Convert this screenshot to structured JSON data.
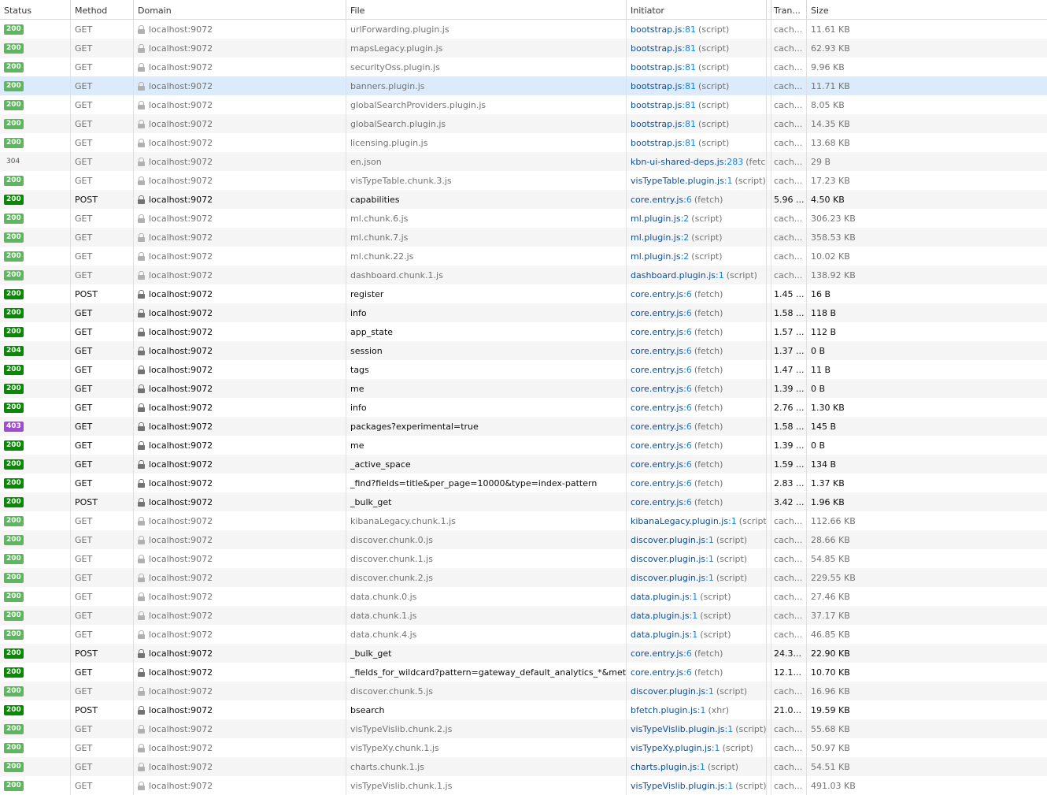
{
  "headers": {
    "status": "Status",
    "method": "Method",
    "domain": "Domain",
    "file": "File",
    "initiator": "Initiator",
    "transferred": "Tran...",
    "size": "Size"
  },
  "colors": {
    "status_ok": "#058b00",
    "status_ok_cached": "#5cb85c",
    "status_forbidden": "#a24ad6",
    "selected_row": "#dcebfb",
    "link": "#0a4ea5"
  },
  "rows": [
    {
      "status": "200",
      "method": "GET",
      "domain": "localhost:9072",
      "file": "urlForwarding.plugin.js",
      "initiator": "bootstrap.js",
      "line": ":81",
      "type": "(script)",
      "transferred": "cach...",
      "size": "11.61 KB",
      "cached": true
    },
    {
      "status": "200",
      "method": "GET",
      "domain": "localhost:9072",
      "file": "mapsLegacy.plugin.js",
      "initiator": "bootstrap.js",
      "line": ":81",
      "type": "(script)",
      "transferred": "cach...",
      "size": "62.93 KB",
      "cached": true
    },
    {
      "status": "200",
      "method": "GET",
      "domain": "localhost:9072",
      "file": "securityOss.plugin.js",
      "initiator": "bootstrap.js",
      "line": ":81",
      "type": "(script)",
      "transferred": "cach...",
      "size": "9.96 KB",
      "cached": true
    },
    {
      "status": "200",
      "method": "GET",
      "domain": "localhost:9072",
      "file": "banners.plugin.js",
      "initiator": "bootstrap.js",
      "line": ":81",
      "type": "(script)",
      "transferred": "cach...",
      "size": "11.71 KB",
      "cached": true,
      "selected": true
    },
    {
      "status": "200",
      "method": "GET",
      "domain": "localhost:9072",
      "file": "globalSearchProviders.plugin.js",
      "initiator": "bootstrap.js",
      "line": ":81",
      "type": "(script)",
      "transferred": "cach...",
      "size": "8.05 KB",
      "cached": true
    },
    {
      "status": "200",
      "method": "GET",
      "domain": "localhost:9072",
      "file": "globalSearch.plugin.js",
      "initiator": "bootstrap.js",
      "line": ":81",
      "type": "(script)",
      "transferred": "cach...",
      "size": "14.35 KB",
      "cached": true
    },
    {
      "status": "200",
      "method": "GET",
      "domain": "localhost:9072",
      "file": "licensing.plugin.js",
      "initiator": "bootstrap.js",
      "line": ":81",
      "type": "(script)",
      "transferred": "cach...",
      "size": "13.68 KB",
      "cached": true
    },
    {
      "status": "304",
      "method": "GET",
      "domain": "localhost:9072",
      "file": "en.json",
      "initiator": "kbn-ui-shared-deps.js",
      "line": ":283",
      "type": "(fetc...",
      "transferred": "cach...",
      "size": "29 B",
      "cached": true
    },
    {
      "status": "200",
      "method": "GET",
      "domain": "localhost:9072",
      "file": "visTypeTable.chunk.3.js",
      "initiator": "visTypeTable.plugin.js",
      "line": ":1",
      "type": "(script)",
      "transferred": "cach...",
      "size": "17.23 KB",
      "cached": true
    },
    {
      "status": "200",
      "method": "POST",
      "domain": "localhost:9072",
      "file": "capabilities",
      "initiator": "core.entry.js",
      "line": ":6",
      "type": "(fetch)",
      "transferred": "5.96 ...",
      "size": "4.50 KB",
      "cached": false
    },
    {
      "status": "200",
      "method": "GET",
      "domain": "localhost:9072",
      "file": "ml.chunk.6.js",
      "initiator": "ml.plugin.js",
      "line": ":2",
      "type": "(script)",
      "transferred": "cach...",
      "size": "306.23 KB",
      "cached": true
    },
    {
      "status": "200",
      "method": "GET",
      "domain": "localhost:9072",
      "file": "ml.chunk.7.js",
      "initiator": "ml.plugin.js",
      "line": ":2",
      "type": "(script)",
      "transferred": "cach...",
      "size": "358.53 KB",
      "cached": true
    },
    {
      "status": "200",
      "method": "GET",
      "domain": "localhost:9072",
      "file": "ml.chunk.22.js",
      "initiator": "ml.plugin.js",
      "line": ":2",
      "type": "(script)",
      "transferred": "cach...",
      "size": "10.02 KB",
      "cached": true
    },
    {
      "status": "200",
      "method": "GET",
      "domain": "localhost:9072",
      "file": "dashboard.chunk.1.js",
      "initiator": "dashboard.plugin.js",
      "line": ":1",
      "type": "(script)",
      "transferred": "cach...",
      "size": "138.92 KB",
      "cached": true
    },
    {
      "status": "200",
      "method": "POST",
      "domain": "localhost:9072",
      "file": "register",
      "initiator": "core.entry.js",
      "line": ":6",
      "type": "(fetch)",
      "transferred": "1.45 ...",
      "size": "16 B",
      "cached": false
    },
    {
      "status": "200",
      "method": "GET",
      "domain": "localhost:9072",
      "file": "info",
      "initiator": "core.entry.js",
      "line": ":6",
      "type": "(fetch)",
      "transferred": "1.58 ...",
      "size": "118 B",
      "cached": false
    },
    {
      "status": "200",
      "method": "GET",
      "domain": "localhost:9072",
      "file": "app_state",
      "initiator": "core.entry.js",
      "line": ":6",
      "type": "(fetch)",
      "transferred": "1.57 ...",
      "size": "112 B",
      "cached": false
    },
    {
      "status": "204",
      "method": "GET",
      "domain": "localhost:9072",
      "file": "session",
      "initiator": "core.entry.js",
      "line": ":6",
      "type": "(fetch)",
      "transferred": "1.37 ...",
      "size": "0 B",
      "cached": false
    },
    {
      "status": "200",
      "method": "GET",
      "domain": "localhost:9072",
      "file": "tags",
      "initiator": "core.entry.js",
      "line": ":6",
      "type": "(fetch)",
      "transferred": "1.47 ...",
      "size": "11 B",
      "cached": false
    },
    {
      "status": "200",
      "method": "GET",
      "domain": "localhost:9072",
      "file": "me",
      "initiator": "core.entry.js",
      "line": ":6",
      "type": "(fetch)",
      "transferred": "1.39 ...",
      "size": "0 B",
      "cached": false
    },
    {
      "status": "200",
      "method": "GET",
      "domain": "localhost:9072",
      "file": "info",
      "initiator": "core.entry.js",
      "line": ":6",
      "type": "(fetch)",
      "transferred": "2.76 ...",
      "size": "1.30 KB",
      "cached": false
    },
    {
      "status": "403",
      "method": "GET",
      "domain": "localhost:9072",
      "file": "packages?experimental=true",
      "initiator": "core.entry.js",
      "line": ":6",
      "type": "(fetch)",
      "transferred": "1.58 ...",
      "size": "145 B",
      "cached": false
    },
    {
      "status": "200",
      "method": "GET",
      "domain": "localhost:9072",
      "file": "me",
      "initiator": "core.entry.js",
      "line": ":6",
      "type": "(fetch)",
      "transferred": "1.39 ...",
      "size": "0 B",
      "cached": false
    },
    {
      "status": "200",
      "method": "GET",
      "domain": "localhost:9072",
      "file": "_active_space",
      "initiator": "core.entry.js",
      "line": ":6",
      "type": "(fetch)",
      "transferred": "1.59 ...",
      "size": "134 B",
      "cached": false
    },
    {
      "status": "200",
      "method": "GET",
      "domain": "localhost:9072",
      "file": "_find?fields=title&per_page=10000&type=index-pattern",
      "initiator": "core.entry.js",
      "line": ":6",
      "type": "(fetch)",
      "transferred": "2.83 ...",
      "size": "1.37 KB",
      "cached": false
    },
    {
      "status": "200",
      "method": "POST",
      "domain": "localhost:9072",
      "file": "_bulk_get",
      "initiator": "core.entry.js",
      "line": ":6",
      "type": "(fetch)",
      "transferred": "3.42 ...",
      "size": "1.96 KB",
      "cached": false
    },
    {
      "status": "200",
      "method": "GET",
      "domain": "localhost:9072",
      "file": "kibanaLegacy.chunk.1.js",
      "initiator": "kibanaLegacy.plugin.js",
      "line": ":1",
      "type": "(script)",
      "transferred": "cach...",
      "size": "112.66 KB",
      "cached": true
    },
    {
      "status": "200",
      "method": "GET",
      "domain": "localhost:9072",
      "file": "discover.chunk.0.js",
      "initiator": "discover.plugin.js",
      "line": ":1",
      "type": "(script)",
      "transferred": "cach...",
      "size": "28.66 KB",
      "cached": true
    },
    {
      "status": "200",
      "method": "GET",
      "domain": "localhost:9072",
      "file": "discover.chunk.1.js",
      "initiator": "discover.plugin.js",
      "line": ":1",
      "type": "(script)",
      "transferred": "cach...",
      "size": "54.85 KB",
      "cached": true
    },
    {
      "status": "200",
      "method": "GET",
      "domain": "localhost:9072",
      "file": "discover.chunk.2.js",
      "initiator": "discover.plugin.js",
      "line": ":1",
      "type": "(script)",
      "transferred": "cach...",
      "size": "229.55 KB",
      "cached": true
    },
    {
      "status": "200",
      "method": "GET",
      "domain": "localhost:9072",
      "file": "data.chunk.0.js",
      "initiator": "data.plugin.js",
      "line": ":1",
      "type": "(script)",
      "transferred": "cach...",
      "size": "27.46 KB",
      "cached": true
    },
    {
      "status": "200",
      "method": "GET",
      "domain": "localhost:9072",
      "file": "data.chunk.1.js",
      "initiator": "data.plugin.js",
      "line": ":1",
      "type": "(script)",
      "transferred": "cach...",
      "size": "37.17 KB",
      "cached": true
    },
    {
      "status": "200",
      "method": "GET",
      "domain": "localhost:9072",
      "file": "data.chunk.4.js",
      "initiator": "data.plugin.js",
      "line": ":1",
      "type": "(script)",
      "transferred": "cach...",
      "size": "46.85 KB",
      "cached": true
    },
    {
      "status": "200",
      "method": "POST",
      "domain": "localhost:9072",
      "file": "_bulk_get",
      "initiator": "core.entry.js",
      "line": ":6",
      "type": "(fetch)",
      "transferred": "24.3...",
      "size": "22.90 KB",
      "cached": false
    },
    {
      "status": "200",
      "method": "GET",
      "domain": "localhost:9072",
      "file": "_fields_for_wildcard?pattern=gateway_default_analytics_*&meta_fie",
      "initiator": "core.entry.js",
      "line": ":6",
      "type": "(fetch)",
      "transferred": "12.1...",
      "size": "10.70 KB",
      "cached": false
    },
    {
      "status": "200",
      "method": "GET",
      "domain": "localhost:9072",
      "file": "discover.chunk.5.js",
      "initiator": "discover.plugin.js",
      "line": ":1",
      "type": "(script)",
      "transferred": "cach...",
      "size": "16.96 KB",
      "cached": true
    },
    {
      "status": "200",
      "method": "POST",
      "domain": "localhost:9072",
      "file": "bsearch",
      "initiator": "bfetch.plugin.js",
      "line": ":1",
      "type": "(xhr)",
      "transferred": "21.0...",
      "size": "19.59 KB",
      "cached": false
    },
    {
      "status": "200",
      "method": "GET",
      "domain": "localhost:9072",
      "file": "visTypeVislib.chunk.2.js",
      "initiator": "visTypeVislib.plugin.js",
      "line": ":1",
      "type": "(script)",
      "transferred": "cach...",
      "size": "55.68 KB",
      "cached": true
    },
    {
      "status": "200",
      "method": "GET",
      "domain": "localhost:9072",
      "file": "visTypeXy.chunk.1.js",
      "initiator": "visTypeXy.plugin.js",
      "line": ":1",
      "type": "(script)",
      "transferred": "cach...",
      "size": "50.97 KB",
      "cached": true
    },
    {
      "status": "200",
      "method": "GET",
      "domain": "localhost:9072",
      "file": "charts.chunk.1.js",
      "initiator": "charts.plugin.js",
      "line": ":1",
      "type": "(script)",
      "transferred": "cach...",
      "size": "54.51 KB",
      "cached": true
    },
    {
      "status": "200",
      "method": "GET",
      "domain": "localhost:9072",
      "file": "visTypeVislib.chunk.1.js",
      "initiator": "visTypeVislib.plugin.js",
      "line": ":1",
      "type": "(script)",
      "transferred": "cach...",
      "size": "491.03 KB",
      "cached": true
    }
  ]
}
